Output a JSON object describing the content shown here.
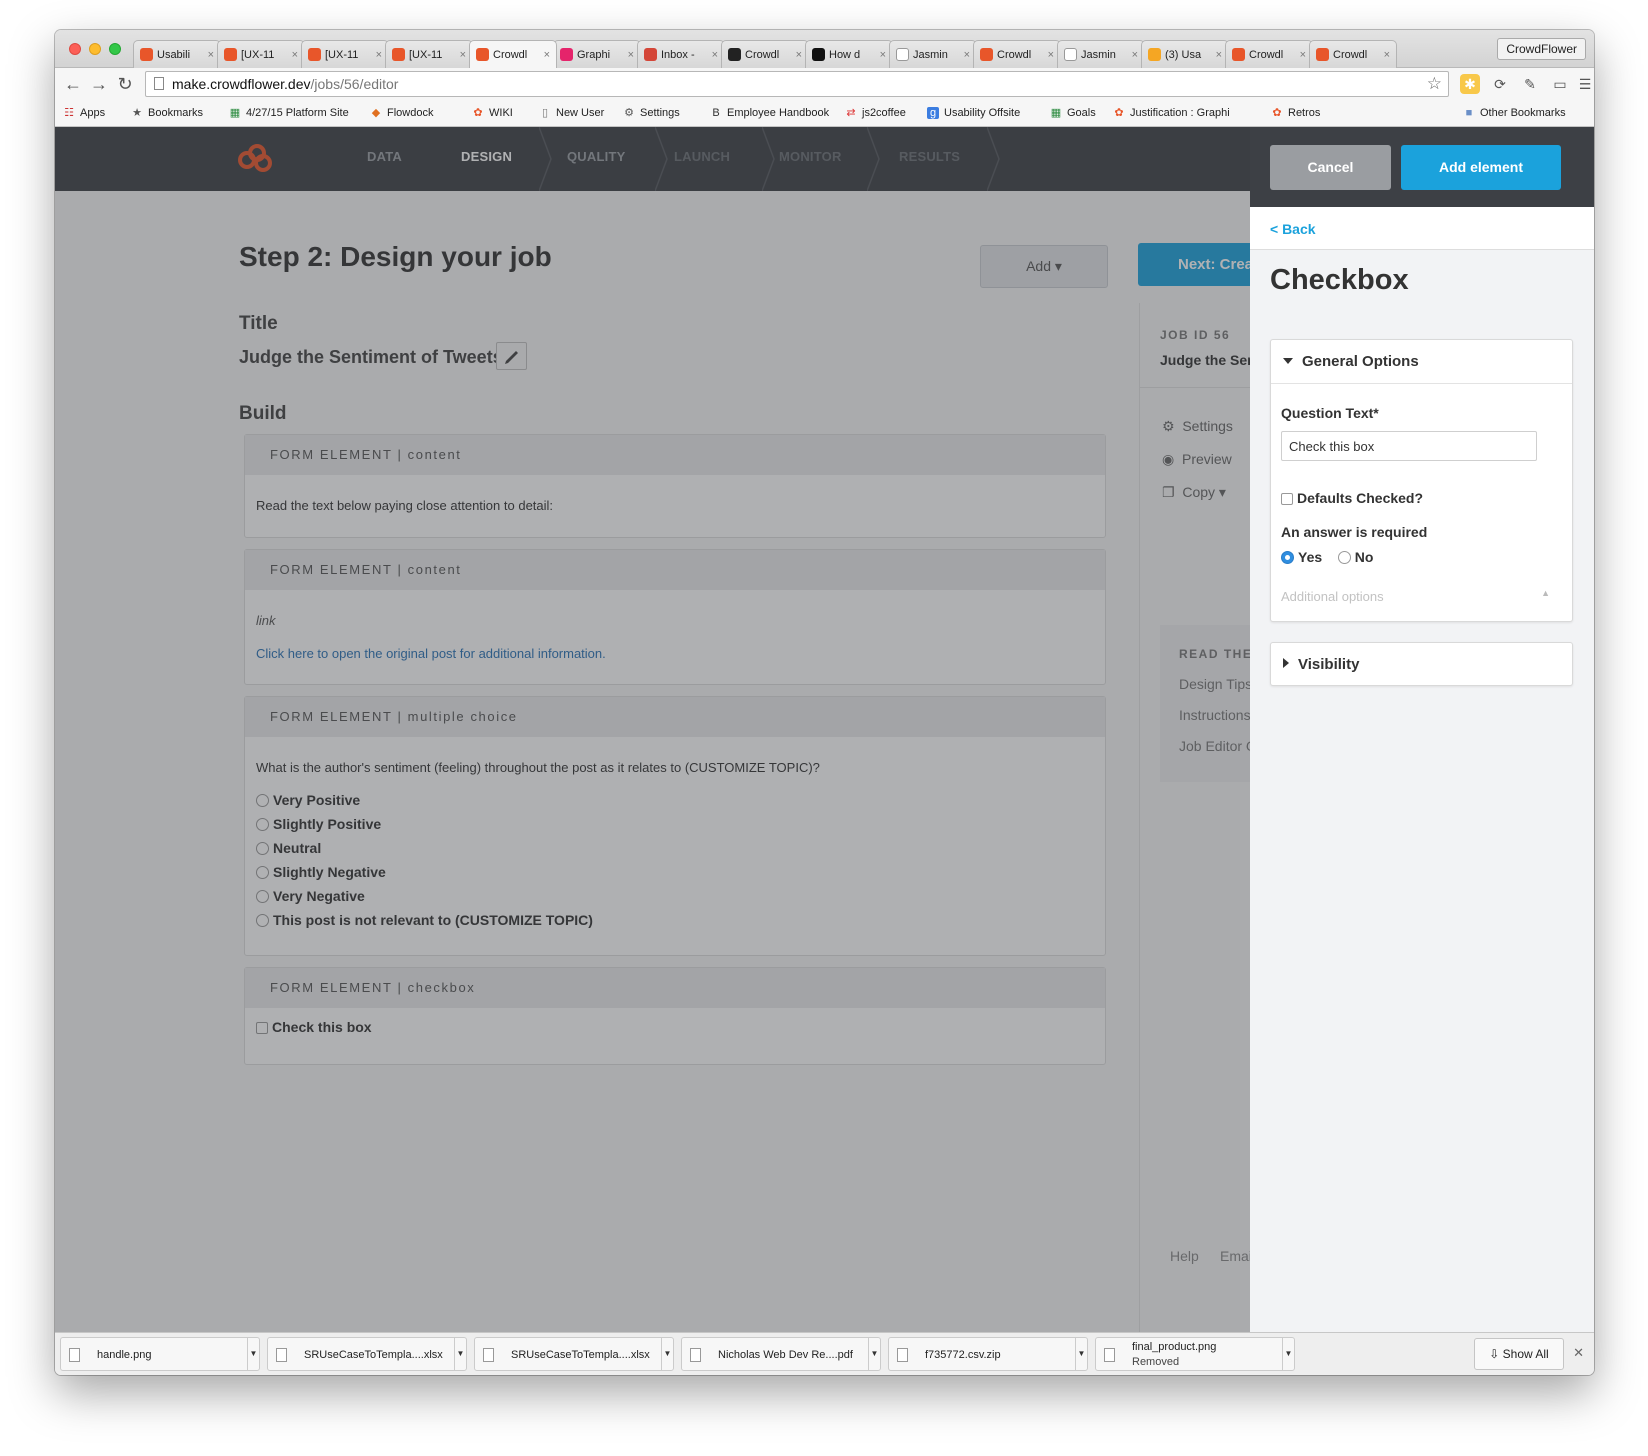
{
  "browser": {
    "tabs": [
      {
        "label": "Usabili",
        "icon": "crowdflower-icon",
        "color": "#e8562a"
      },
      {
        "label": "[UX-11",
        "icon": "crowdflower-icon",
        "color": "#e8562a"
      },
      {
        "label": "[UX-11",
        "icon": "crowdflower-icon",
        "color": "#e8562a"
      },
      {
        "label": "[UX-11",
        "icon": "crowdflower-icon",
        "color": "#e8562a"
      },
      {
        "label": "Crowdl",
        "icon": "crowdflower-icon",
        "color": "#e8562a"
      },
      {
        "label": "Graphi",
        "icon": "invision-icon",
        "color": "#e5246b"
      },
      {
        "label": "Inbox -",
        "icon": "gmail-icon",
        "color": "#d44638"
      },
      {
        "label": "Crowdl",
        "icon": "github-icon",
        "color": "#222222"
      },
      {
        "label": "How d",
        "icon": "medium-icon",
        "color": "#111111"
      },
      {
        "label": "Jasmin",
        "icon": "document-icon",
        "color": "#ffffff"
      },
      {
        "label": "Crowdl",
        "icon": "crowdflower-icon",
        "color": "#e8562a"
      },
      {
        "label": "Jasmin",
        "icon": "document-icon",
        "color": "#ffffff"
      },
      {
        "label": "(3) Usa",
        "icon": "flowdock-icon",
        "color": "#f5a623"
      },
      {
        "label": "Crowdl",
        "icon": "crowdflower-icon",
        "color": "#e8562a"
      },
      {
        "label": "Crowdl",
        "icon": "crowdflower-icon",
        "color": "#e8562a"
      }
    ],
    "active_tab_index": 4,
    "profile_label": "CrowdFlower",
    "url_host": "make.crowdflower.dev",
    "url_path": "/jobs/56/editor",
    "bookmarks": [
      {
        "label": "Apps",
        "icon": "apps-grid-icon"
      },
      {
        "label": "Bookmarks",
        "icon": "star-icon"
      },
      {
        "label": "4/27/15 Platform Site",
        "icon": "sheet-icon"
      },
      {
        "label": "Flowdock",
        "icon": "flowdock-icon"
      },
      {
        "label": "WIKI",
        "icon": "crowdflower-icon"
      },
      {
        "label": "New User",
        "icon": "document-icon"
      },
      {
        "label": "Settings",
        "icon": "gear-icon"
      },
      {
        "label": "Employee Handbook",
        "icon": "handbook-icon"
      },
      {
        "label": "js2coffee",
        "icon": "arrows-icon"
      },
      {
        "label": "Usability Offsite",
        "icon": "google-icon"
      },
      {
        "label": "Goals",
        "icon": "sheet-icon"
      },
      {
        "label": "Justification : Graphi",
        "icon": "crowdflower-icon"
      },
      {
        "label": "Retros",
        "icon": "crowdflower-icon"
      }
    ],
    "other_bookmarks": "Other Bookmarks"
  },
  "app": {
    "steps": [
      {
        "label": "DATA",
        "state": "done"
      },
      {
        "label": "DESIGN",
        "state": "current"
      },
      {
        "label": "QUALITY",
        "state": "upcoming"
      },
      {
        "label": "LAUNCH",
        "state": "locked"
      },
      {
        "label": "MONITOR",
        "state": "locked"
      },
      {
        "label": "RESULTS",
        "state": "locked"
      }
    ],
    "page_title": "Step 2: Design your job",
    "add_button": "Add",
    "next_button": "Next: Create",
    "title_heading": "Title",
    "job_title": "Judge the Sentiment of Tweets",
    "build_heading": "Build",
    "form_elements": [
      {
        "header": "FORM ELEMENT | content",
        "text": "Read the text below paying close attention to detail:"
      },
      {
        "header": "FORM ELEMENT | content",
        "label": "link",
        "link_text": "Click here to open the original post for additional information."
      },
      {
        "header": "FORM ELEMENT | multiple choice",
        "question": "What is the author's sentiment (feeling) throughout the post as it relates to (CUSTOMIZE TOPIC)?",
        "options": [
          "Very Positive",
          "Slightly Positive",
          "Neutral",
          "Slightly Negative",
          "Very Negative",
          "This post is not relevant to (CUSTOMIZE TOPIC)"
        ]
      },
      {
        "header": "FORM ELEMENT | checkbox",
        "checkbox_label": "Check this box"
      }
    ],
    "sidebar": {
      "job_id": "JOB ID 56",
      "job_name": "Judge the Sentiment of Tweets",
      "links": [
        "Settings",
        "Preview",
        "Copy"
      ],
      "read_heading": "READ THE DOCS",
      "docs": [
        "Design Tips",
        "Instructions",
        "Job Editor Guide"
      ],
      "footer": [
        "Help",
        "Email"
      ]
    }
  },
  "drawer": {
    "cancel": "Cancel",
    "add_element": "Add element",
    "back": "< Back",
    "title": "Checkbox",
    "general_options": {
      "heading": "General Options",
      "question_label": "Question Text*",
      "question_value": "Check this box",
      "defaults_checked_label": "Defaults Checked?",
      "defaults_checked": false,
      "required_label": "An answer is required",
      "yes": "Yes",
      "no": "No",
      "required": "Yes",
      "additional_options": "Additional options"
    },
    "visibility_heading": "Visibility"
  },
  "downloads": {
    "items": [
      {
        "name": "handle.png"
      },
      {
        "name": "SRUseCaseToTempla....xlsx"
      },
      {
        "name": "SRUseCaseToTempla....xlsx"
      },
      {
        "name": "Nicholas Web Dev Re....pdf"
      },
      {
        "name": "f735772.csv.zip"
      },
      {
        "name": "final_product.png",
        "status": "Removed"
      }
    ],
    "show_all": "Show All"
  },
  "colors": {
    "accent": "#1ba2dc",
    "brand_orange": "#e8562a",
    "app_bar": "#3d4045"
  }
}
